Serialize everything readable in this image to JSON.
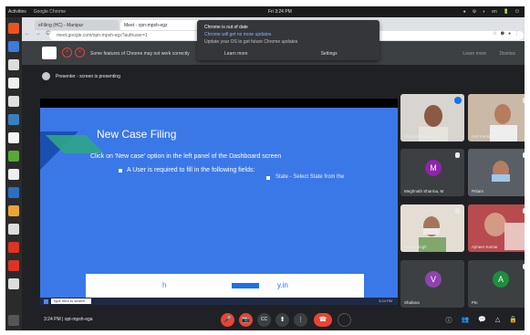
{
  "os_bar": {
    "activities": "Activities",
    "app": "Google Chrome",
    "clock": "Fri 3:24 PM",
    "tray": [
      "●",
      "⚙",
      "◐",
      "en",
      "🔋",
      "⏻"
    ]
  },
  "browser": {
    "tabs": [
      "eFiling (HC) - Manipur",
      "Meet - opn-mpsh-egz"
    ],
    "address": "meet.google.com/opn-mpsh-egz?authuser=1",
    "nav": "← → C"
  },
  "notification": {
    "title": "Chrome is out of date",
    "subtitle": "Chrome will get no more updates",
    "body": "Update your OS to get future Chrome updates",
    "action_left": "Learn more",
    "action_right": "Settings"
  },
  "infobar": {
    "message": "Some features of Chrome may not work correctly",
    "learn_more": "Learn more",
    "dismiss": "Dismiss"
  },
  "presenting": {
    "text": "Presenter - screen is presenting"
  },
  "slide": {
    "title": "New Case Filing",
    "line1": "Click on 'New case' option in the left panel of the Dashboard screen",
    "line2": "A User is required to fill in the following fields:",
    "line3": "State - Select State from the",
    "inner_left": "h",
    "inner_right": "y.in"
  },
  "taskbar": {
    "search": "Type here to search",
    "time": "3:24 PM"
  },
  "participants": [
    {
      "name": "Presenter saturan",
      "initial": "",
      "color": "#ffffff"
    },
    {
      "name": "Anil Kumar",
      "initial": "",
      "color": "#ffffff"
    },
    {
      "name": "Meghnath Sharma, M",
      "initial": "M",
      "color": "#8e24aa"
    },
    {
      "name": "Pritam",
      "initial": "",
      "color": "#ffffff"
    },
    {
      "name": "Ratan Singh",
      "initial": "",
      "color": "#ffffff"
    },
    {
      "name": "Ajmeer Kumar",
      "initial": "",
      "color": "#ffffff"
    },
    {
      "name": "Shafana",
      "initial": "V",
      "color": "#8e44ad"
    },
    {
      "name": "Pin",
      "initial": "A",
      "color": "#1e8e3e"
    }
  ],
  "meeting": {
    "time": "3:24 PM",
    "code": "opt-mpsh-ega"
  },
  "controls": {
    "mic": "🎤",
    "cam": "📷",
    "cc": "CC",
    "present": "⬆",
    "more": "⋮",
    "hangup": "☎"
  }
}
